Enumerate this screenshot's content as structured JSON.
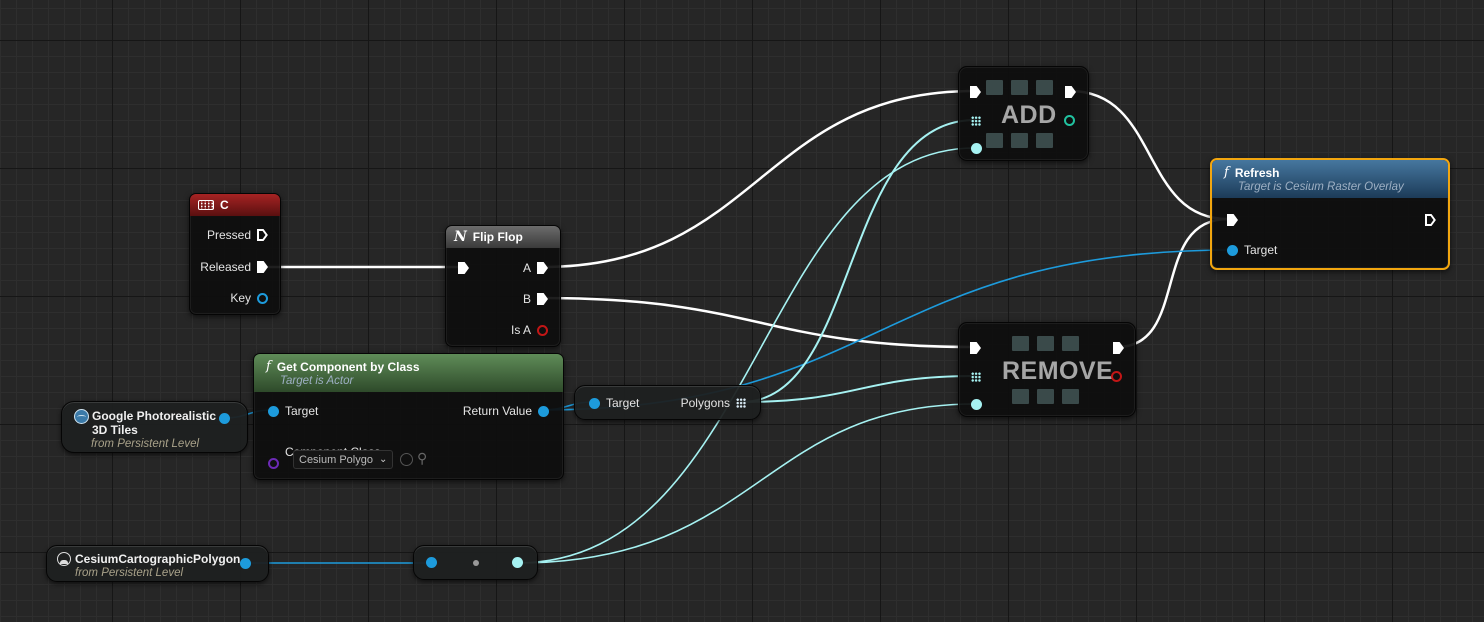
{
  "colors": {
    "exec_wire": "#ffffff",
    "object_wire": "#1d9bdc",
    "array_wire": "#a6f2f2",
    "event_header": "#8d1a1a",
    "function_header": "#3f6a3a",
    "flipflop_header": "#555555",
    "refresh_header": "#2e5a80",
    "selection_border": "#f2a60f"
  },
  "key_event": {
    "title": "C",
    "icon": "keyboard-icon",
    "pins": {
      "pressed": "Pressed",
      "released": "Released",
      "key": "Key"
    }
  },
  "flip_flop": {
    "title": "Flip Flop",
    "icon": "flipflop-icon",
    "pins": {
      "a": "A",
      "b": "B",
      "is_a": "Is A"
    }
  },
  "get_component": {
    "title": "Get Component by Class",
    "subtitle": "Target is Actor",
    "icon": "function-icon",
    "pins": {
      "target": "Target",
      "component_class": "Component Class",
      "return_value": "Return Value"
    },
    "class_value": "Cesium Polygo"
  },
  "tiles_var": {
    "title_line1": "Google Photorealistic",
    "title_line2": "3D Tiles",
    "subtitle": "from Persistent Level",
    "icon": "globe-icon"
  },
  "polygons_getter": {
    "target": "Target",
    "polygons": "Polygons"
  },
  "polygon_var": {
    "title": "CesiumCartographicPolygon",
    "subtitle": "from Persistent Level",
    "icon": "polygon-icon"
  },
  "add_macro": {
    "title": "ADD"
  },
  "remove_macro": {
    "title": "REMOVE"
  },
  "refresh": {
    "title": "Refresh",
    "subtitle": "Target is Cesium Raster Overlay",
    "icon": "function-icon",
    "pins": {
      "target": "Target"
    }
  }
}
